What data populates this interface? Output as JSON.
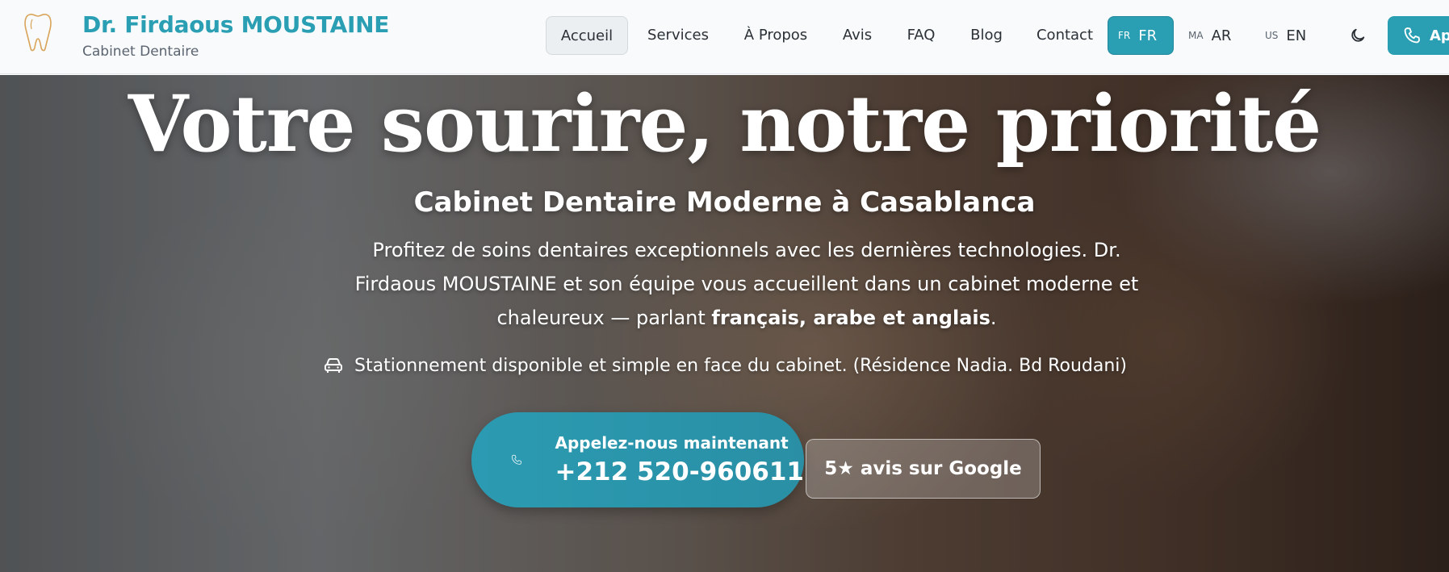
{
  "brand": {
    "name": "Dr. Firdaous MOUSTAINE",
    "subtitle": "Cabinet Dentaire",
    "logo_icon": "tooth-icon"
  },
  "nav": {
    "items": [
      {
        "label": "Accueil",
        "active": true
      },
      {
        "label": "Services",
        "active": false
      },
      {
        "label": "À Propos",
        "active": false
      },
      {
        "label": "Avis",
        "active": false
      },
      {
        "label": "FAQ",
        "active": false
      },
      {
        "label": "Blog",
        "active": false
      },
      {
        "label": "Contact",
        "active": false
      }
    ],
    "languages": [
      {
        "code": "FR",
        "label": "FR",
        "active": true
      },
      {
        "code": "MA",
        "label": "AR",
        "active": false
      },
      {
        "code": "US",
        "label": "EN",
        "active": false
      }
    ],
    "theme_icon": "moon-icon",
    "cta_label": "Ap",
    "cta_icon": "phone-icon"
  },
  "hero": {
    "title": "Votre sourire, notre priorité",
    "subtitle": "Cabinet Dentaire Moderne à Casablanca",
    "description_part1": "Profitez de soins dentaires exceptionnels avec les dernières technologies. Dr. Firdaous MOUSTAINE et son équipe vous accueillent dans un cabinet moderne et chaleureux — parlant ",
    "description_bold": "français, arabe et anglais",
    "description_end": ".",
    "parking_text": "Stationnement disponible et simple en face du cabinet. (Résidence Nadia. Bd Roudani)",
    "parking_icon": "car-icon",
    "call_label": "Appelez-nous maintenant",
    "call_number": "+212 520-960611",
    "call_icon": "phone-icon",
    "google_label": "5★ avis sur Google"
  },
  "colors": {
    "accent": "#2a9fb4",
    "logo": "#d9a45a",
    "text": "#2b3036"
  }
}
